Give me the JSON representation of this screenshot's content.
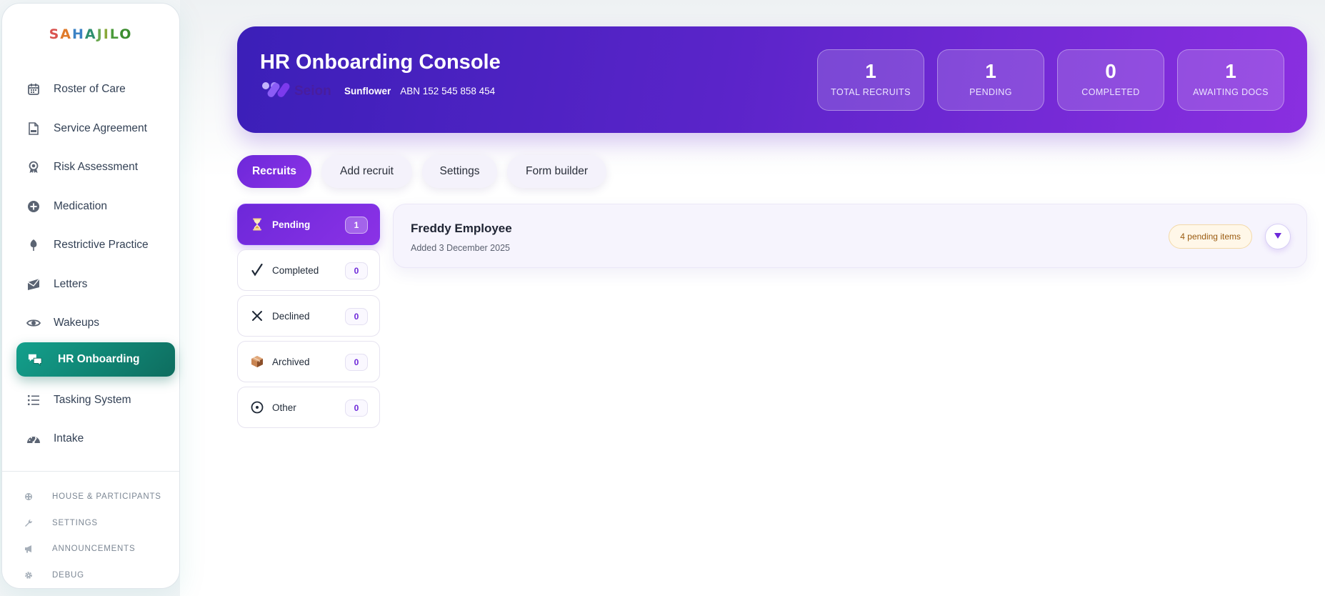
{
  "sidebar": {
    "brand_letters": [
      "S",
      "A",
      "H",
      "A",
      "J",
      "I",
      "L",
      "O"
    ],
    "items": [
      {
        "label": "Roster of Care",
        "icon": "calendar-icon"
      },
      {
        "label": "Service Agreement",
        "icon": "document-icon"
      },
      {
        "label": "Risk Assessment",
        "icon": "badge-icon"
      },
      {
        "label": "Medication",
        "icon": "plus-circle-icon"
      },
      {
        "label": "Restrictive Practice",
        "icon": "leaf-icon"
      },
      {
        "label": "Letters",
        "icon": "envelope-icon"
      },
      {
        "label": "Wakeups",
        "icon": "eye-icon"
      },
      {
        "label": "HR Onboarding",
        "icon": "chat-bubbles-icon",
        "active": true
      },
      {
        "label": "Tasking System",
        "icon": "list-icon"
      },
      {
        "label": "Intake",
        "icon": "dashboard-icon"
      }
    ],
    "sub_items": [
      {
        "label": "HOUSE & PARTICIPANTS",
        "icon": "grid-icon"
      },
      {
        "label": "SETTINGS",
        "icon": "wrench-icon"
      },
      {
        "label": "ANNOUNCEMENTS",
        "icon": "megaphone-icon"
      },
      {
        "label": "DEBUG",
        "icon": "gear-icon"
      }
    ]
  },
  "banner": {
    "title": "HR Onboarding Console",
    "logo_text": "Seion",
    "org_name": "Sunflower",
    "abn": "ABN 152 545 858 454",
    "stats": [
      {
        "value": "1",
        "label": "TOTAL RECRUITS"
      },
      {
        "value": "1",
        "label": "PENDING"
      },
      {
        "value": "0",
        "label": "COMPLETED"
      },
      {
        "value": "1",
        "label": "AWAITING DOCS"
      }
    ]
  },
  "tabs": [
    {
      "label": "Recruits",
      "active": true
    },
    {
      "label": "Add recruit"
    },
    {
      "label": "Settings"
    },
    {
      "label": "Form builder"
    }
  ],
  "filters": [
    {
      "label": "Pending",
      "count": "1",
      "icon": "hourglass-icon",
      "active": true
    },
    {
      "label": "Completed",
      "count": "0",
      "icon": "check-icon"
    },
    {
      "label": "Declined",
      "count": "0",
      "icon": "x-icon"
    },
    {
      "label": "Archived",
      "count": "0",
      "icon": "box-icon"
    },
    {
      "label": "Other",
      "count": "0",
      "icon": "dot-circle-icon"
    }
  ],
  "recruit": {
    "name": "Freddy Employee",
    "added": "Added 3 December 2025",
    "status": "4 pending items"
  },
  "colors": {
    "accent": "#6d28d9",
    "sidebar_active": "#0e6d5f",
    "banner_start": "#3b1fb8",
    "banner_end": "#8a2fe0"
  }
}
